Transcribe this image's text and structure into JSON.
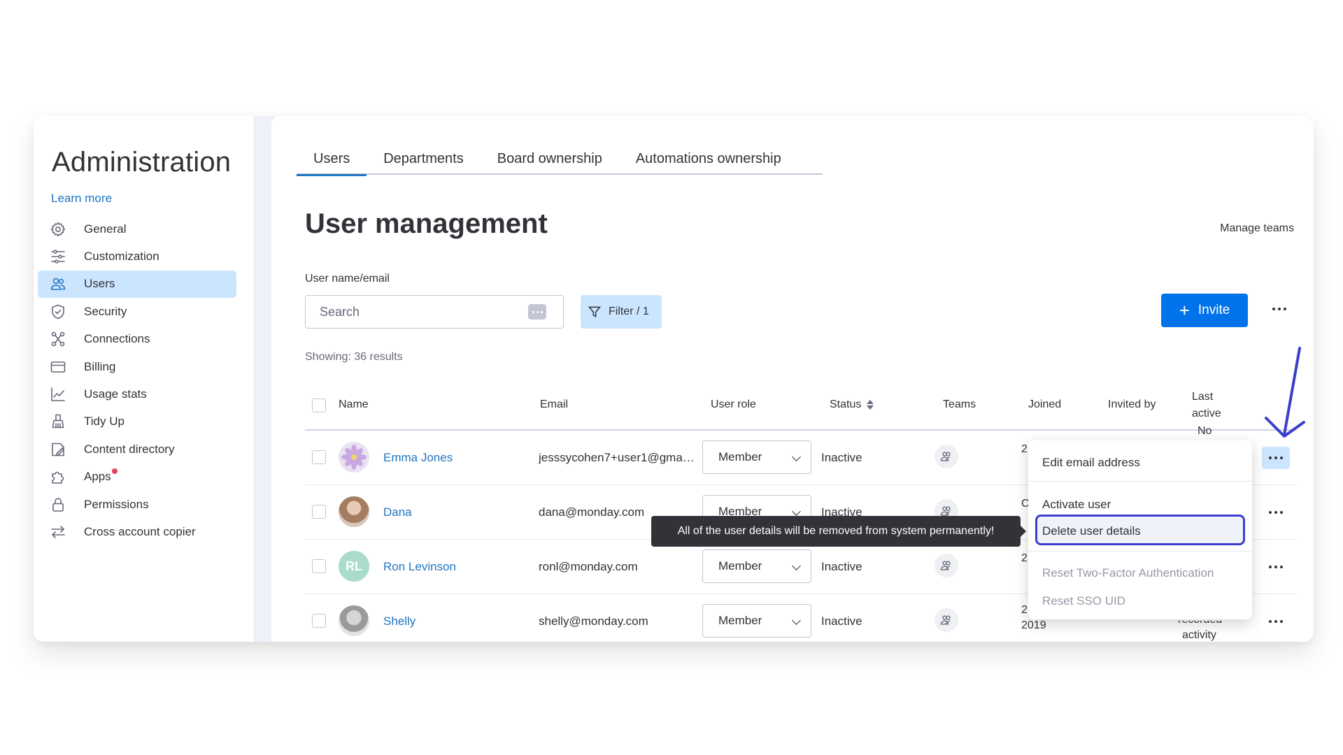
{
  "sidebar": {
    "title": "Administration",
    "learn_more": "Learn more",
    "items": [
      {
        "label": "General",
        "icon": "gear-icon"
      },
      {
        "label": "Customization",
        "icon": "sliders-icon"
      },
      {
        "label": "Users",
        "icon": "users-icon",
        "active": true
      },
      {
        "label": "Security",
        "icon": "shield-icon"
      },
      {
        "label": "Connections",
        "icon": "connections-icon"
      },
      {
        "label": "Billing",
        "icon": "credit-card-icon"
      },
      {
        "label": "Usage stats",
        "icon": "chart-icon"
      },
      {
        "label": "Tidy Up",
        "icon": "broom-icon"
      },
      {
        "label": "Content directory",
        "icon": "folder-icon"
      },
      {
        "label": "Apps",
        "icon": "puzzle-icon",
        "badge_color": "#e2445c"
      },
      {
        "label": "Permissions",
        "icon": "lock-icon"
      },
      {
        "label": "Cross account copier",
        "icon": "arrows-icon"
      }
    ]
  },
  "tabs": [
    {
      "label": "Users",
      "active": true
    },
    {
      "label": "Departments"
    },
    {
      "label": "Board ownership"
    },
    {
      "label": "Automations ownership"
    }
  ],
  "page": {
    "title": "User management",
    "manage_teams": "Manage teams",
    "field_label": "User name/email",
    "search_placeholder": "Search",
    "filter_label": "Filter / 1",
    "invite_label": "Invite",
    "showing": "Showing: 36 results"
  },
  "table": {
    "headers": {
      "name": "Name",
      "email": "Email",
      "role": "User role",
      "status": "Status",
      "teams": "Teams",
      "joined": "Joined",
      "invited_by": "Invited by",
      "last_active_1": "Last",
      "last_active_2": "active"
    },
    "rows": [
      {
        "name": "Emma Jones",
        "email": "jesssycohen7+user1@gmail...",
        "role": "Member",
        "status": "Inactive",
        "avatar": "flower",
        "joined_frag": "2",
        "last_active_frag": "No"
      },
      {
        "name": "Dana",
        "email": "dana@monday.com",
        "role": "Member",
        "status": "Inactive",
        "avatar": "photo",
        "joined_frag": "C"
      },
      {
        "name": "Ron Levinson",
        "email": "ronl@monday.com",
        "role": "Member",
        "status": "Inactive",
        "avatar": "initials",
        "initials": "RL",
        "avatar_color": "#a9dcc9",
        "joined_frag": "2"
      },
      {
        "name": "Shelly",
        "email": "shelly@monday.com",
        "role": "Member",
        "status": "Inactive",
        "avatar": "photo",
        "joined_frag": "2",
        "joined_year": "2019",
        "last_active_frag_1": "recorded",
        "last_active_frag_2": "activity"
      }
    ]
  },
  "menu": {
    "items": [
      {
        "label": "Edit email address",
        "enabled": true
      },
      {
        "label": "Activate user",
        "enabled": true
      },
      {
        "label": "Delete user details",
        "enabled": true,
        "highlighted": true
      },
      {
        "label": "Reset Two-Factor Authentication",
        "enabled": false
      },
      {
        "label": "Reset SSO UID",
        "enabled": false
      }
    ]
  },
  "tooltip": "All of the user details will be removed from system permanently!",
  "colors": {
    "primary": "#0073ea",
    "link": "#1f76c2",
    "active_bg": "#cce5ff",
    "annotation": "#3b3fcc"
  }
}
